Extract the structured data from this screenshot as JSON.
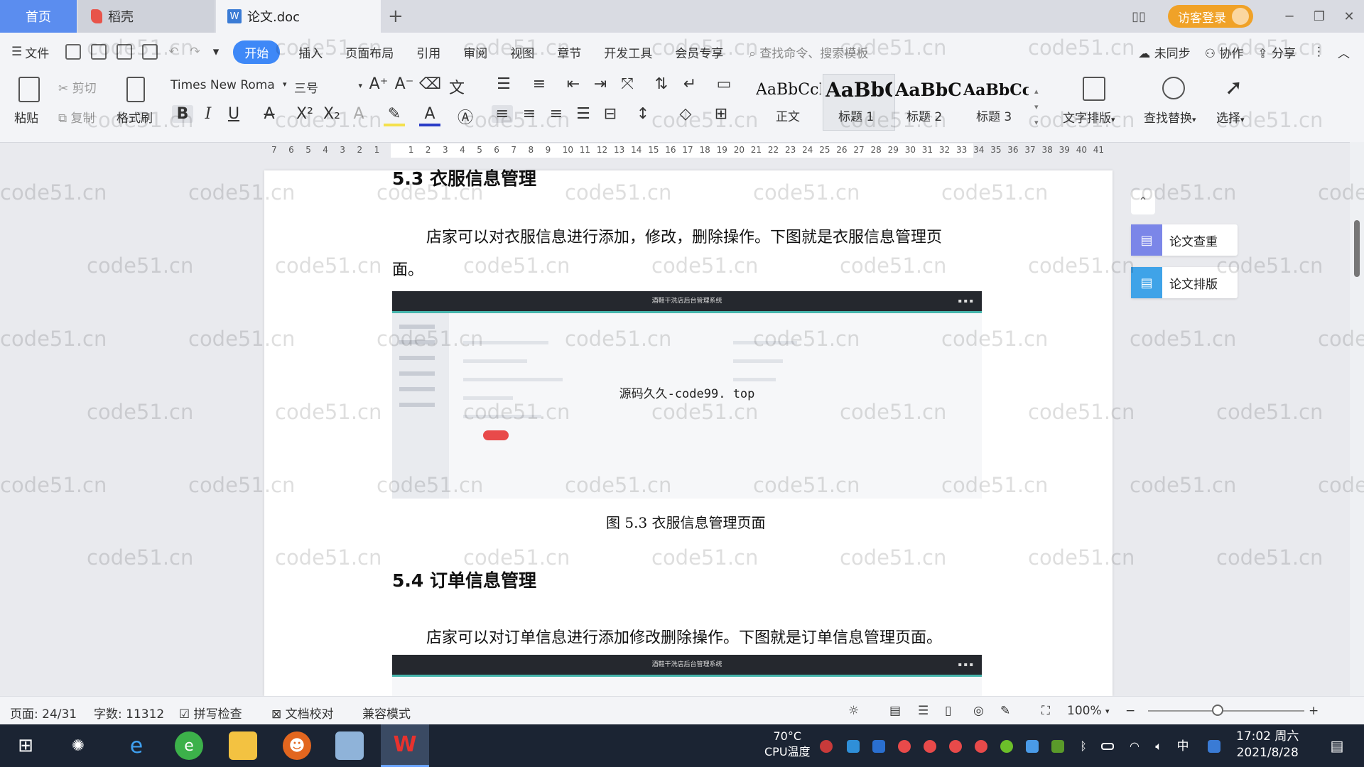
{
  "tabs": {
    "home": "首页",
    "daoke": "稻壳",
    "doc": "论文.doc",
    "doc_icon": "W",
    "add": "+",
    "login": "访客登录"
  },
  "menu": {
    "file": "文件",
    "items": [
      "开始",
      "插入",
      "页面布局",
      "引用",
      "审阅",
      "视图",
      "章节",
      "开发工具",
      "会员专享"
    ],
    "search_placeholder": "查找命令、搜索模板",
    "sync": "未同步",
    "collab": "协作",
    "share": "分享"
  },
  "ribbon": {
    "paste": "粘贴",
    "cut": "剪切",
    "copy": "复制",
    "format_painter": "格式刷",
    "font_name": "Times New Roma",
    "font_size": "三号",
    "styles": [
      {
        "sample": "AaBbCcI",
        "label": "正文"
      },
      {
        "sample": "AaBbC",
        "label": "标题 1"
      },
      {
        "sample": "AaBbC",
        "label": "标题 2"
      },
      {
        "sample": "AaBbCcl",
        "label": "标题 3"
      }
    ],
    "text_layout": "文字排版",
    "find_replace": "查找替换",
    "select": "选择"
  },
  "ruler_ticks": [
    "7",
    "6",
    "5",
    "4",
    "3",
    "2",
    "1",
    "",
    "1",
    "2",
    "3",
    "4",
    "5",
    "6",
    "7",
    "8",
    "9",
    "10",
    "11",
    "12",
    "13",
    "14",
    "15",
    "16",
    "17",
    "18",
    "19",
    "20",
    "21",
    "22",
    "23",
    "24",
    "25",
    "26",
    "27",
    "28",
    "29",
    "30",
    "31",
    "32",
    "33",
    "34",
    "35",
    "36",
    "37",
    "38",
    "39",
    "40",
    "41"
  ],
  "document": {
    "heading1": "5.3  衣服信息管理",
    "para1_line1": "店家可以对衣服信息进行添加，修改，删除操作。下图就是衣服信息管理页",
    "para1_line2": "面。",
    "figure1_header": "酒鞋干洗店后台管理系统",
    "figure1_watermark": "源码久久-code99. top",
    "caption1": "图 5.3  衣服信息管理页面",
    "heading2": "5.4  订单信息管理",
    "para2": "店家可以对订单信息进行添加修改删除操作。下图就是订单信息管理页面。",
    "figure2_header": "酒鞋干洗店后台管理系统"
  },
  "side_panel": {
    "plagiarism_check": "论文查重",
    "paper_layout": "论文排版"
  },
  "watermark_text": "code51.cn",
  "status": {
    "page": "页面: 24/31",
    "words": "字数: 11312",
    "spellcheck": "拼写检查",
    "proofread": "文档校对",
    "compat": "兼容模式",
    "zoom": "100%"
  },
  "taskbar": {
    "cpu_temp": "70°C",
    "cpu_label": "CPU温度",
    "ime": "中",
    "time": "17:02 周六",
    "date": "2021/8/28"
  },
  "colors": {
    "accent": "#3e88f7",
    "home_tab": "#5b8def",
    "login": "#f0a228",
    "taskbar": "#1b2433"
  }
}
